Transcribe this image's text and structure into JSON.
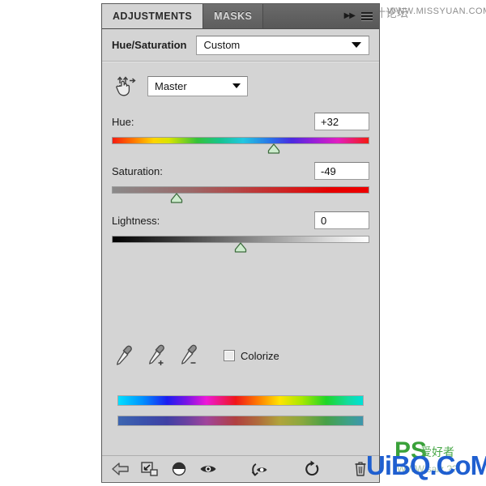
{
  "panel": {
    "tabs": [
      {
        "label": "ADJUSTMENTS",
        "active": true
      },
      {
        "label": "MASKS",
        "active": false
      }
    ],
    "collapse_arrows": "▶▶",
    "menu_icon": "hamburger-menu-icon",
    "title": "Hue/Saturation",
    "preset": {
      "value": "Custom",
      "caret_icon": "chevron-down-icon"
    },
    "channel": {
      "value": "Master",
      "caret_icon": "chevron-down-icon"
    },
    "scrubby_tool_icon": "on-image-adjustment-hand-icon",
    "sliders": [
      {
        "label": "Hue:",
        "value": "+32",
        "percent": 63,
        "track": "hue-rainbow-gradient"
      },
      {
        "label": "Saturation:",
        "value": "-49",
        "percent": 25,
        "track": "gray-to-red-gradient"
      },
      {
        "label": "Lightness:",
        "value": "0",
        "percent": 50,
        "track": "black-to-white-gradient"
      }
    ],
    "eyedroppers": [
      {
        "icon": "eyedropper-icon",
        "name": "sample-color"
      },
      {
        "icon": "eyedropper-plus-icon",
        "name": "add-to-sample"
      },
      {
        "icon": "eyedropper-minus-icon",
        "name": "subtract-from-sample"
      }
    ],
    "colorize": {
      "label": "Colorize",
      "checked": false
    },
    "color_bars": {
      "top": "vivid-spectrum-bar",
      "bottom": "muted-spectrum-bar"
    },
    "bottom_toolbar": [
      {
        "icon": "back-arrow-icon",
        "name": "return-to-adjustment-list"
      },
      {
        "icon": "clip-to-layer-icon",
        "name": "clip-to-layer-button"
      },
      {
        "icon": "half-circle-icon",
        "name": "toggle-layer-mask-button"
      },
      {
        "icon": "eye-icon",
        "name": "toggle-visibility-button"
      },
      {
        "icon": "eye-previous-state-icon",
        "name": "preview-previous-state-button"
      },
      {
        "icon": "reset-circular-arrow-icon",
        "name": "reset-adjustment-button"
      },
      {
        "icon": "trash-icon",
        "name": "delete-adjustment-button"
      }
    ]
  },
  "watermarks": {
    "top_cn": "思缘设计论坛",
    "top_url": "WWW.MISSYUAN.COM",
    "bottom_main": "UiBQ.CoM",
    "bottom_ps": "PS",
    "bottom_ps_sub": "爱好者",
    "bottom_salz": "WWW.salz.??"
  }
}
